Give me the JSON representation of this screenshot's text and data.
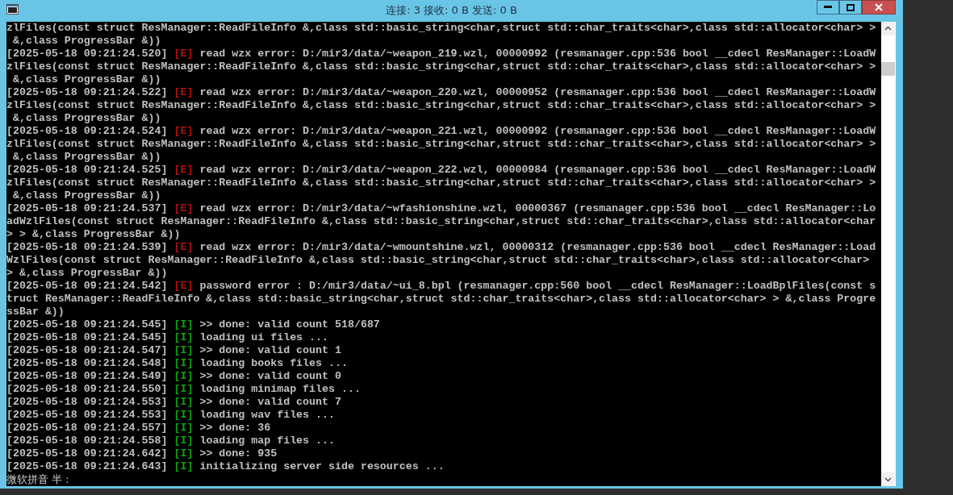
{
  "window": {
    "title": "连接: 3 接收: 0 B 发送: 0 B"
  },
  "console": {
    "rows": [
      {
        "kind": "continuation",
        "text": "zlFiles(const struct ResManager::ReadFileInfo &,class std::basic_string<char,struct std::char_traits<char>,class std::allocator<char> >"
      },
      {
        "kind": "continuation",
        "text": " &,class ProgressBar &))"
      },
      {
        "kind": "entry",
        "timestamp": "[2025-05-18 09:21:24.520]",
        "color": "#b01010",
        "tag": "[E]",
        "message": "read wzx error: D:/mir3/data/~weapon_219.wzl, 00000992 (resmanager.cpp:536 bool __cdecl ResManager::LoadW"
      },
      {
        "kind": "continuation",
        "text": "zlFiles(const struct ResManager::ReadFileInfo &,class std::basic_string<char,struct std::char_traits<char>,class std::allocator<char> >"
      },
      {
        "kind": "continuation",
        "text": " &,class ProgressBar &))"
      },
      {
        "kind": "entry",
        "timestamp": "[2025-05-18 09:21:24.522]",
        "color": "#b01010",
        "tag": "[E]",
        "message": "read wzx error: D:/mir3/data/~weapon_220.wzl, 00000952 (resmanager.cpp:536 bool __cdecl ResManager::LoadW"
      },
      {
        "kind": "continuation",
        "text": "zlFiles(const struct ResManager::ReadFileInfo &,class std::basic_string<char,struct std::char_traits<char>,class std::allocator<char> >"
      },
      {
        "kind": "continuation",
        "text": " &,class ProgressBar &))"
      },
      {
        "kind": "entry",
        "timestamp": "[2025-05-18 09:21:24.524]",
        "color": "#b01010",
        "tag": "[E]",
        "message": "read wzx error: D:/mir3/data/~weapon_221.wzl, 00000992 (resmanager.cpp:536 bool __cdecl ResManager::LoadW"
      },
      {
        "kind": "continuation",
        "text": "zlFiles(const struct ResManager::ReadFileInfo &,class std::basic_string<char,struct std::char_traits<char>,class std::allocator<char> >"
      },
      {
        "kind": "continuation",
        "text": " &,class ProgressBar &))"
      },
      {
        "kind": "entry",
        "timestamp": "[2025-05-18 09:21:24.525]",
        "color": "#b01010",
        "tag": "[E]",
        "message": "read wzx error: D:/mir3/data/~weapon_222.wzl, 00000984 (resmanager.cpp:536 bool __cdecl ResManager::LoadW"
      },
      {
        "kind": "continuation",
        "text": "zlFiles(const struct ResManager::ReadFileInfo &,class std::basic_string<char,struct std::char_traits<char>,class std::allocator<char> >"
      },
      {
        "kind": "continuation",
        "text": " &,class ProgressBar &))"
      },
      {
        "kind": "entry",
        "timestamp": "[2025-05-18 09:21:24.537]",
        "color": "#b01010",
        "tag": "[E]",
        "message": "read wzx error: D:/mir3/data/~wfashionshine.wzl, 00000367 (resmanager.cpp:536 bool __cdecl ResManager::Lo"
      },
      {
        "kind": "continuation",
        "text": "adWzlFiles(const struct ResManager::ReadFileInfo &,class std::basic_string<char,struct std::char_traits<char>,class std::allocator<char"
      },
      {
        "kind": "continuation",
        "text": "> > &,class ProgressBar &))"
      },
      {
        "kind": "entry",
        "timestamp": "[2025-05-18 09:21:24.539]",
        "color": "#b01010",
        "tag": "[E]",
        "message": "read wzx error: D:/mir3/data/~wmountshine.wzl, 00000312 (resmanager.cpp:536 bool __cdecl ResManager::Load"
      },
      {
        "kind": "continuation",
        "text": "WzlFiles(const struct ResManager::ReadFileInfo &,class std::basic_string<char,struct std::char_traits<char>,class std::allocator<char>"
      },
      {
        "kind": "continuation",
        "text": "> &,class ProgressBar &))"
      },
      {
        "kind": "entry",
        "timestamp": "[2025-05-18 09:21:24.542]",
        "color": "#b01010",
        "tag": "[E]",
        "message": "password error : D:/mir3/data/~ui_8.bpl (resmanager.cpp:560 bool __cdecl ResManager::LoadBplFiles(const s"
      },
      {
        "kind": "continuation",
        "text": "truct ResManager::ReadFileInfo &,class std::basic_string<char,struct std::char_traits<char>,class std::allocator<char> > &,class Progre"
      },
      {
        "kind": "continuation",
        "text": "ssBar &))"
      },
      {
        "kind": "entry",
        "timestamp": "[2025-05-18 09:21:24.545]",
        "color": "#10a010",
        "tag": "[I]",
        "message": ">> done: valid count 518/687"
      },
      {
        "kind": "entry",
        "timestamp": "[2025-05-18 09:21:24.545]",
        "color": "#10a010",
        "tag": "[I]",
        "message": "loading ui files ..."
      },
      {
        "kind": "entry",
        "timestamp": "[2025-05-18 09:21:24.547]",
        "color": "#10a010",
        "tag": "[I]",
        "message": ">> done: valid count 1"
      },
      {
        "kind": "entry",
        "timestamp": "[2025-05-18 09:21:24.548]",
        "color": "#10a010",
        "tag": "[I]",
        "message": "loading books files ..."
      },
      {
        "kind": "entry",
        "timestamp": "[2025-05-18 09:21:24.549]",
        "color": "#10a010",
        "tag": "[I]",
        "message": ">> done: valid count 0"
      },
      {
        "kind": "entry",
        "timestamp": "[2025-05-18 09:21:24.550]",
        "color": "#10a010",
        "tag": "[I]",
        "message": "loading minimap files ..."
      },
      {
        "kind": "entry",
        "timestamp": "[2025-05-18 09:21:24.553]",
        "color": "#10a010",
        "tag": "[I]",
        "message": ">> done: valid count 7"
      },
      {
        "kind": "entry",
        "timestamp": "[2025-05-18 09:21:24.553]",
        "color": "#10a010",
        "tag": "[I]",
        "message": "loading wav files ..."
      },
      {
        "kind": "entry",
        "timestamp": "[2025-05-18 09:21:24.557]",
        "color": "#10a010",
        "tag": "[I]",
        "message": ">> done: 36"
      },
      {
        "kind": "entry",
        "timestamp": "[2025-05-18 09:21:24.558]",
        "color": "#10a010",
        "tag": "[I]",
        "message": "loading map files ..."
      },
      {
        "kind": "entry",
        "timestamp": "[2025-05-18 09:21:24.642]",
        "color": "#10a010",
        "tag": "[I]",
        "message": ">> done: 935"
      },
      {
        "kind": "entry",
        "timestamp": "[2025-05-18 09:21:24.643]",
        "color": "#10a010",
        "tag": "[I]",
        "message": "initializing server side resources ..."
      }
    ],
    "ime_status": "微软拼音 半 :"
  }
}
